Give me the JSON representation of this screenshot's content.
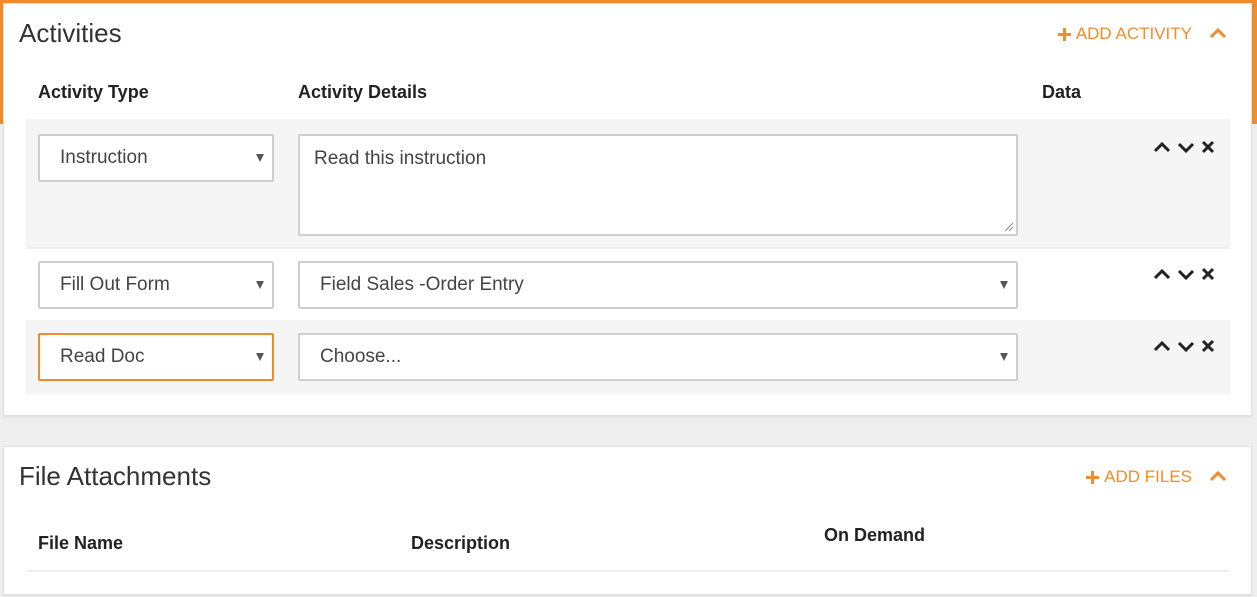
{
  "colors": {
    "accent": "#f28c28",
    "row_bg": "#f5f5f5",
    "text": "#333333"
  },
  "activities": {
    "title": "Activities",
    "add_label": "ADD ACTIVITY",
    "add_icon": "plus-icon",
    "collapse_icon": "chevron-up-icon",
    "columns": {
      "type": "Activity Type",
      "details": "Activity Details",
      "data": "Data"
    },
    "rows": [
      {
        "type": "Instruction",
        "details_kind": "textarea",
        "details": "Read this instruction",
        "controls": [
          "move-up-icon",
          "move-down-icon",
          "delete-icon"
        ]
      },
      {
        "type": "Fill Out Form",
        "details_kind": "select",
        "details": "Field Sales -Order Entry",
        "controls": [
          "move-up-icon",
          "move-down-icon",
          "delete-icon"
        ]
      },
      {
        "type": "Read Doc",
        "details_kind": "select",
        "details": "Choose...",
        "controls": [
          "move-up-icon",
          "move-down-icon",
          "delete-icon"
        ]
      }
    ]
  },
  "files": {
    "title": "File Attachments",
    "add_label": "ADD FILES",
    "add_icon": "plus-icon",
    "collapse_icon": "chevron-up-icon",
    "columns": {
      "name": "File Name",
      "description": "Description",
      "on_demand": "On Demand"
    }
  }
}
